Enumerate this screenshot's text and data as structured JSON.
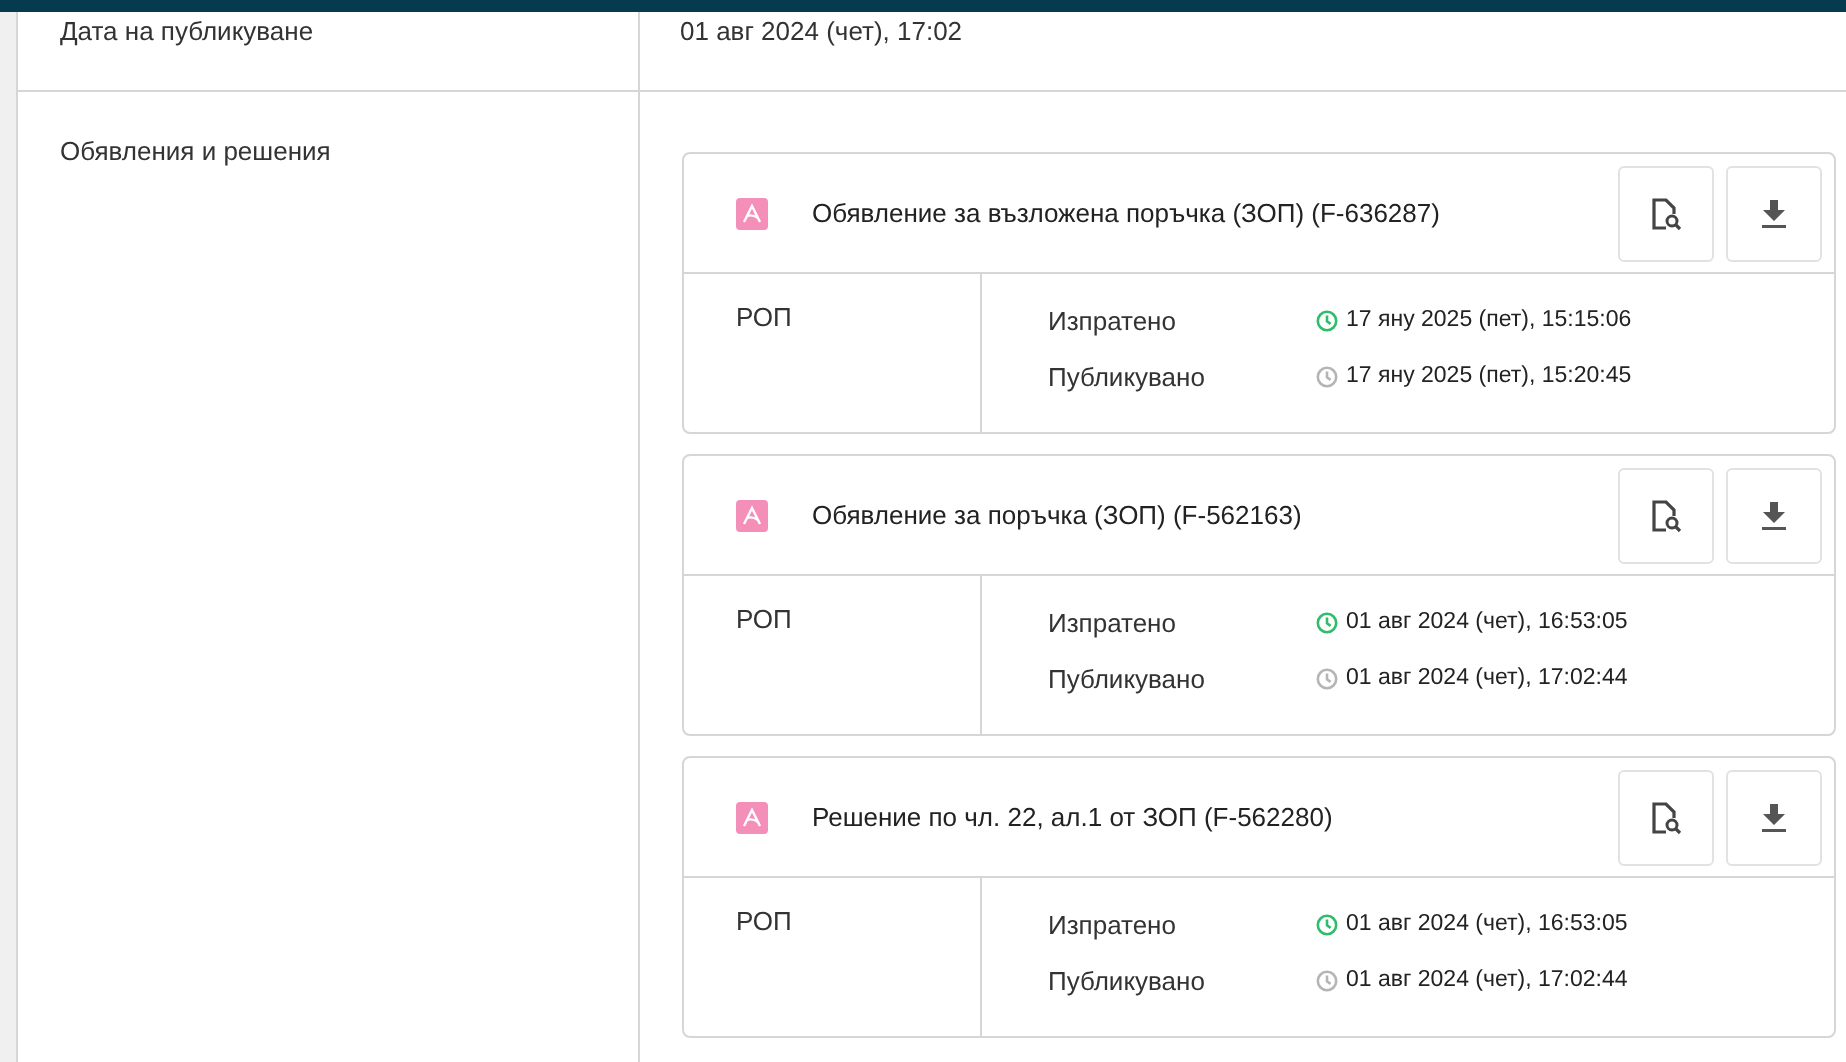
{
  "rows": [
    {
      "label": "Дата на публикуване",
      "value": "01 авг 2024 (чет), 17:02"
    },
    {
      "label": "Обявления и решения"
    }
  ],
  "notices": [
    {
      "title": "Обявление за възложена поръчка (ЗОП) (F-636287)",
      "source": "РОП",
      "events": [
        {
          "label": "Изпратено",
          "time": "17 яну 2025 (пет), 15:15:06",
          "color": "#2ebd6b"
        },
        {
          "label": "Публикувано",
          "time": "17 яну 2025 (пет), 15:20:45",
          "color": "#b5b5b5"
        }
      ]
    },
    {
      "title": "Обявление за поръчка (ЗОП) (F-562163)",
      "source": "РОП",
      "events": [
        {
          "label": "Изпратено",
          "time": "01 авг 2024 (чет), 16:53:05",
          "color": "#2ebd6b"
        },
        {
          "label": "Публикувано",
          "time": "01 авг 2024 (чет), 17:02:44",
          "color": "#b5b5b5"
        }
      ]
    },
    {
      "title": "Решение по чл. 22, ал.1 от ЗОП (F-562280)",
      "source": "РОП",
      "events": [
        {
          "label": "Изпратено",
          "time": "01 авг 2024 (чет), 16:53:05",
          "color": "#2ebd6b"
        },
        {
          "label": "Публикувано",
          "time": "01 авг 2024 (чет), 17:02:44",
          "color": "#b5b5b5"
        }
      ]
    }
  ]
}
